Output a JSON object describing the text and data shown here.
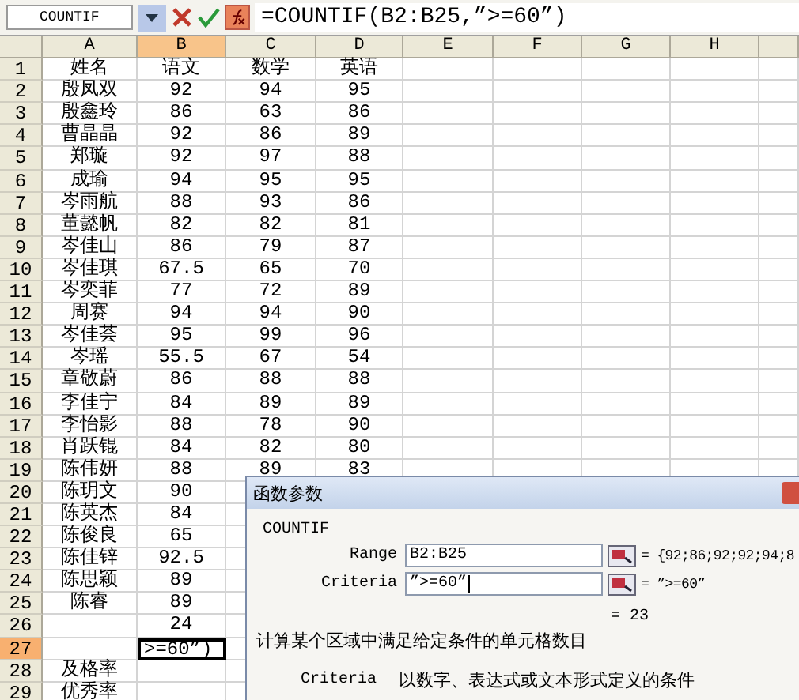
{
  "formula_bar": {
    "name_box": "COUNTIF",
    "formula": "=COUNTIF(B2:B25,”>=60”)"
  },
  "columns": [
    {
      "label": "A",
      "selected": false
    },
    {
      "label": "B",
      "selected": true
    },
    {
      "label": "C",
      "selected": false
    },
    {
      "label": "D",
      "selected": false
    },
    {
      "label": "E",
      "selected": false
    },
    {
      "label": "F",
      "selected": false
    },
    {
      "label": "G",
      "selected": false
    },
    {
      "label": "H",
      "selected": false
    }
  ],
  "rows": [
    {
      "number": "1",
      "selected": false,
      "cells": {
        "name": "姓名",
        "chinese": "语文",
        "math": "数学",
        "english": "英语"
      }
    },
    {
      "number": "2",
      "selected": false,
      "cells": {
        "name": "殷凤双",
        "chinese": "92",
        "math": "94",
        "english": "95"
      }
    },
    {
      "number": "3",
      "selected": false,
      "cells": {
        "name": "殷鑫玲",
        "chinese": "86",
        "math": "63",
        "english": "86"
      }
    },
    {
      "number": "4",
      "selected": false,
      "cells": {
        "name": "曹晶晶",
        "chinese": "92",
        "math": "86",
        "english": "89"
      }
    },
    {
      "number": "5",
      "selected": false,
      "cells": {
        "name": "郑璇",
        "chinese": "92",
        "math": "97",
        "english": "88"
      }
    },
    {
      "number": "6",
      "selected": false,
      "cells": {
        "name": "成瑜",
        "chinese": "94",
        "math": "95",
        "english": "95"
      }
    },
    {
      "number": "7",
      "selected": false,
      "cells": {
        "name": "岑雨航",
        "chinese": "88",
        "math": "93",
        "english": "86"
      }
    },
    {
      "number": "8",
      "selected": false,
      "cells": {
        "name": "董懿帆",
        "chinese": "82",
        "math": "82",
        "english": "81"
      }
    },
    {
      "number": "9",
      "selected": false,
      "cells": {
        "name": "岑佳山",
        "chinese": "86",
        "math": "79",
        "english": "87"
      }
    },
    {
      "number": "10",
      "selected": false,
      "cells": {
        "name": "岑佳琪",
        "chinese": "67.5",
        "math": "65",
        "english": "70"
      }
    },
    {
      "number": "11",
      "selected": false,
      "cells": {
        "name": "岑奕菲",
        "chinese": "77",
        "math": "72",
        "english": "89"
      }
    },
    {
      "number": "12",
      "selected": false,
      "cells": {
        "name": "周赛",
        "chinese": "94",
        "math": "94",
        "english": "90"
      }
    },
    {
      "number": "13",
      "selected": false,
      "cells": {
        "name": "岑佳荟",
        "chinese": "95",
        "math": "99",
        "english": "96"
      }
    },
    {
      "number": "14",
      "selected": false,
      "cells": {
        "name": "岑瑶",
        "chinese": "55.5",
        "math": "67",
        "english": "54"
      }
    },
    {
      "number": "15",
      "selected": false,
      "cells": {
        "name": "章敬蔚",
        "chinese": "86",
        "math": "88",
        "english": "88"
      }
    },
    {
      "number": "16",
      "selected": false,
      "cells": {
        "name": "李佳宁",
        "chinese": "84",
        "math": "89",
        "english": "89"
      }
    },
    {
      "number": "17",
      "selected": false,
      "cells": {
        "name": "李怡影",
        "chinese": "88",
        "math": "78",
        "english": "90"
      }
    },
    {
      "number": "18",
      "selected": false,
      "cells": {
        "name": "肖跃锟",
        "chinese": "84",
        "math": "82",
        "english": "80"
      }
    },
    {
      "number": "19",
      "selected": false,
      "cells": {
        "name": "陈伟妍",
        "chinese": "88",
        "math": "89",
        "english": "83"
      }
    },
    {
      "number": "20",
      "selected": false,
      "cells": {
        "name": "陈玥文",
        "chinese": "90"
      }
    },
    {
      "number": "21",
      "selected": false,
      "cells": {
        "name": "陈英杰",
        "chinese": "84"
      }
    },
    {
      "number": "22",
      "selected": false,
      "cells": {
        "name": "陈俊良",
        "chinese": "65"
      }
    },
    {
      "number": "23",
      "selected": false,
      "cells": {
        "name": "陈佳锌",
        "chinese": "92.5"
      }
    },
    {
      "number": "24",
      "selected": false,
      "cells": {
        "name": "陈思颖",
        "chinese": "89"
      }
    },
    {
      "number": "25",
      "selected": false,
      "cells": {
        "name": "陈睿",
        "chinese": "89"
      }
    },
    {
      "number": "26",
      "selected": false,
      "cells": {
        "chinese": "24"
      }
    },
    {
      "number": "27",
      "selected": true,
      "cells": {
        "chinese": ">=60”)"
      }
    },
    {
      "number": "28",
      "selected": false,
      "cells": {
        "name": "及格率"
      }
    },
    {
      "number": "29",
      "selected": false,
      "cells": {
        "name": "优秀率"
      }
    }
  ],
  "dialog": {
    "title": "函数参数",
    "function_name": "COUNTIF",
    "arguments": [
      {
        "label": "Range",
        "value": "B2:B25",
        "result": "= {92;86;92;92;94;8"
      },
      {
        "label": "Criteria",
        "value": "”>=60”",
        "result": "= ”>=60”"
      }
    ],
    "result": "= 23",
    "description": "计算某个区域中满足给定条件的单元格数目",
    "argument_help": {
      "label": "Criteria",
      "text": "以数字、表达式或文本形式定义的条件"
    }
  }
}
